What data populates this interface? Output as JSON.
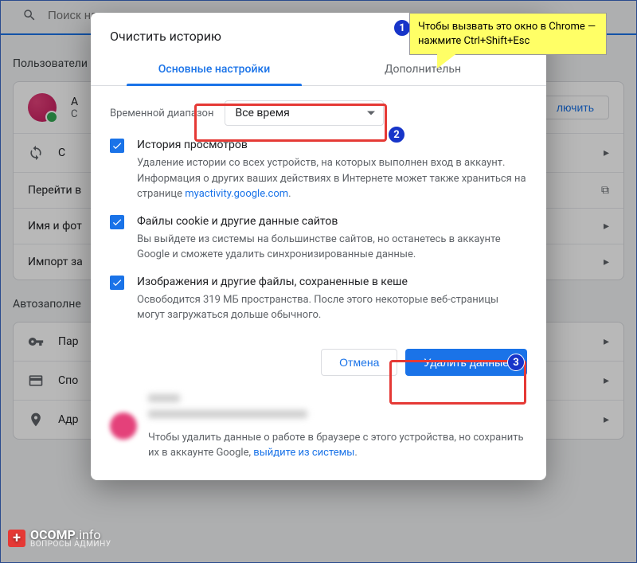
{
  "search": {
    "placeholder": "Поиск настроек"
  },
  "bg": {
    "section1": "Пользователи",
    "account_line1": "А",
    "account_line2": "С",
    "sync_label": "С",
    "off_button": "лючить",
    "row_goto": "Перейти в",
    "row_name": "Имя и фот",
    "row_import": "Импорт за",
    "section2": "Автозаполне",
    "row_pass": "Пар",
    "row_pay": "Спо",
    "row_addr": "Адр"
  },
  "dialog": {
    "title": "Очистить историю",
    "tab_basic": "Основные настройки",
    "tab_adv": "Дополнительн",
    "range_label": "Временной диапазон",
    "range_value": "Все время",
    "items": [
      {
        "title": "История просмотров",
        "desc_pre": "Удаление истории со всех устройств, на которых выполнен вход в аккаунт. Информация о других ваших действиях в Интернете может также храниться на странице ",
        "link": "myactivity.google.com",
        "desc_post": "."
      },
      {
        "title": "Файлы cookie и другие данные сайтов",
        "desc_pre": "Вы выйдете из системы на большинстве сайтов, но останетесь в аккаунте Google и сможете удалить синхронизированные данные.",
        "link": "",
        "desc_post": ""
      },
      {
        "title": "Изображения и другие файлы, сохраненные в кеше",
        "desc_pre": "Освободится 319 МБ пространства. После этого некоторые веб-страницы могут загружаться дольше обычного.",
        "link": "",
        "desc_post": ""
      }
    ],
    "cancel": "Отмена",
    "confirm": "Удалить данные",
    "footer_pre": "Чтобы удалить данные о работе в браузере с этого устройства, но сохранить их в аккаунте Google, ",
    "footer_link": "выйдите из системы",
    "footer_post": "."
  },
  "annotation": {
    "note": "Чтобы вызвать это окно в Chrome — нажмите Ctrl+Shift+Esc",
    "n1": "1",
    "n2": "2",
    "n3": "3"
  },
  "watermark": {
    "brand": "OCOMP",
    "tld": ".info",
    "sub": "ВОПРОСЫ АДМИНУ"
  }
}
